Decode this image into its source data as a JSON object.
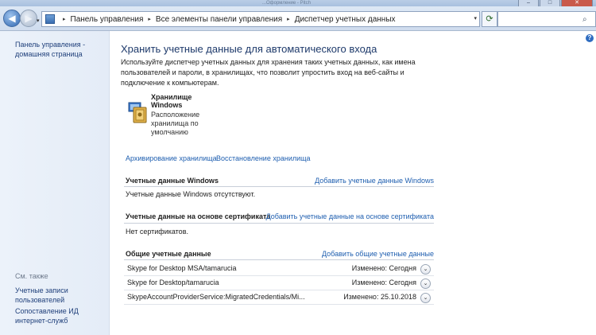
{
  "window": {
    "title_partial": "...Оформление - Pitch",
    "min": "–",
    "max": "□",
    "close": "✕"
  },
  "nav": {
    "back": "◀",
    "forward": "▶",
    "dropdown": "▾",
    "refresh": "⟳"
  },
  "breadcrumb": {
    "items": [
      "Панель управления",
      "Все элементы панели управления",
      "Диспетчер учетных данных"
    ],
    "separator": "▸"
  },
  "search": {
    "placeholder": "",
    "icon": "search-icon"
  },
  "sidebar": {
    "home_line1": "Панель управления -",
    "home_line2": "домашняя страница",
    "see_also": "См. также",
    "links": [
      {
        "line1": "Учетные записи",
        "line2": "пользователей"
      },
      {
        "line1": "Сопоставление ИД",
        "line2": "интернет-служб"
      }
    ]
  },
  "help": "?",
  "main": {
    "title": "Хранить учетные данные для автоматического входа",
    "description": "Используйте диспетчер учетных данных для хранения таких учетных данных, как имена пользователей и пароли, в хранилищах, что позволит упростить вход на веб-сайты и подключение к компьютерам.",
    "vault": {
      "title_line1": "Хранилище",
      "title_line2": "Windows",
      "sub_line1": "Расположение",
      "sub_line2": "хранилища по",
      "sub_line3": "умолчанию"
    },
    "backup_link": "Архивирование хранилища",
    "restore_link": "Восстановление хранилища",
    "sections": [
      {
        "heading": "Учетные данные Windows",
        "add_link": "Добавить учетные данные Windows",
        "empty_text": "Учетные данные Windows отсутствуют."
      },
      {
        "heading": "Учетные данные на основе сертификата",
        "add_link": "Добавить учетные данные на основе сертификата",
        "empty_text": "Нет сертификатов."
      },
      {
        "heading": "Общие учетные данные",
        "add_link": "Добавить общие учетные данные",
        "items": [
          {
            "name": "Skype for Desktop MSA/tamarucia",
            "modified": "Изменено:  Сегодня"
          },
          {
            "name": "Skype for Desktop/tamarucia",
            "modified": "Изменено:  Сегодня"
          },
          {
            "name": "SkypeAccountProviderService:MigratedCredentials/Mi...",
            "modified": "Изменено:  25.10.2018"
          }
        ]
      }
    ]
  },
  "colors": {
    "link": "#1f5fb0",
    "title": "#1e3a6b",
    "sidebar_bg": "#e8eff9"
  }
}
